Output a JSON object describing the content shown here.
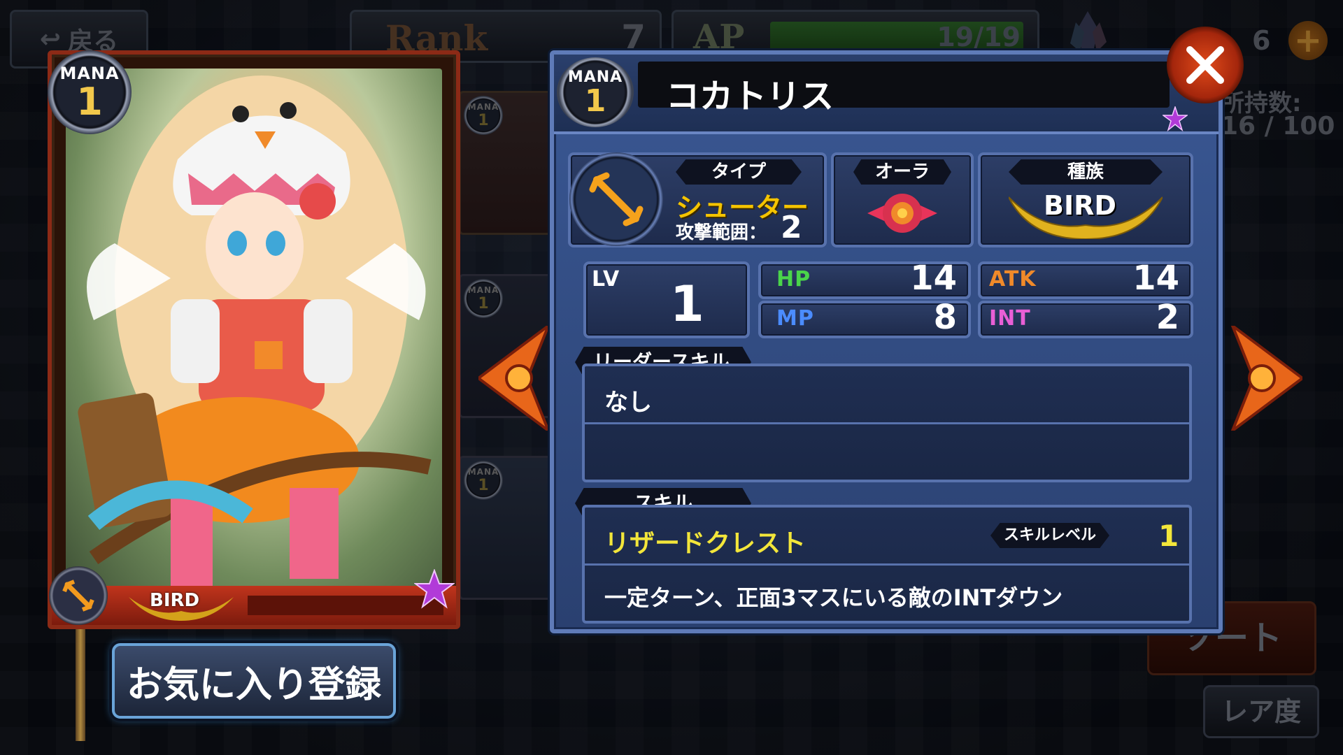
{
  "topbar": {
    "back_label": "戻る",
    "rank_label": "Rank",
    "rank_value": "7",
    "ap_label": "AP",
    "ap_value": "19/19",
    "ap_fraction": 1.0,
    "crystal_count": "6",
    "plus_label": "+"
  },
  "owned": {
    "label": "所持数:",
    "value": "16 / 100"
  },
  "card": {
    "mana_label": "MANA",
    "mana_value": "1",
    "tribe_label": "BIRD",
    "rarity_icon": "purple-star"
  },
  "list_cards": [
    {
      "mana_label": "MANA",
      "mana_value": "1"
    },
    {
      "mana_label": "MANA",
      "mana_value": "1"
    },
    {
      "mana_label": "MANA",
      "mana_value": "1"
    }
  ],
  "detail": {
    "mana_label": "MANA",
    "mana_value": "1",
    "name": "コカトリス",
    "type_tag": "タイプ",
    "type_value": "シューター",
    "range_label": "攻撃範囲：",
    "range_value": "2",
    "aura_tag": "オーラ",
    "tribe_tag": "種族",
    "tribe_value": "BIRD",
    "lv_label": "LV",
    "lv_value": "1",
    "hp_label": "HP",
    "hp_value": "14",
    "atk_label": "ATK",
    "atk_value": "14",
    "mp_label": "MP",
    "mp_value": "8",
    "int_label": "INT",
    "int_value": "2",
    "leader_tag": "リーダースキル",
    "leader_value": "なし",
    "skill_tag": "スキル",
    "skill_name": "リザードクレスト",
    "skill_level_tag": "スキルレベル",
    "skill_level_value": "1",
    "skill_desc": "一定ターン、正面3マスにいる敵のINTダウン"
  },
  "buttons": {
    "favorite": "お気に入り登録",
    "sort": "ソート",
    "rarity": "レア度"
  },
  "colors": {
    "type_yellow": "#f5c400",
    "hp_green": "#4ad44a",
    "mp_blue": "#4b8cff",
    "atk_orange": "#f08a2a",
    "int_pink": "#e95fd6",
    "skill_yellow": "#f3e63a"
  }
}
